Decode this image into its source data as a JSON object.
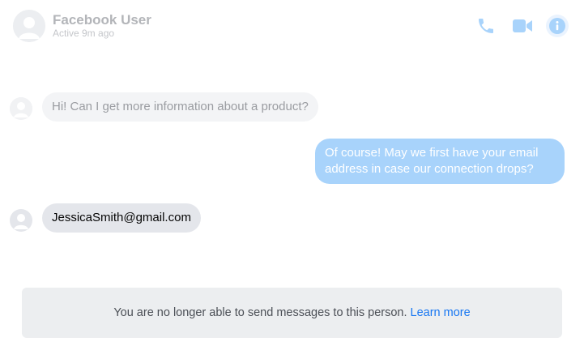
{
  "header": {
    "name": "Facebook User",
    "status": "Active 9m ago",
    "icons": {
      "phone": "phone-icon",
      "video": "video-camera-icon",
      "info": "info-icon"
    }
  },
  "messages": [
    {
      "direction": "incoming",
      "text": "Hi! Can I get more information about a product?",
      "faded": true
    },
    {
      "direction": "outgoing",
      "text": "Of course! May we first have your email address in case our connection drops?"
    },
    {
      "direction": "incoming",
      "text": "JessicaSmith@gmail.com"
    }
  ],
  "notice": {
    "text": "You are no longer able to send messages to this person.",
    "link_label": "Learn more"
  },
  "colors": {
    "accent": "#1877f2",
    "outgoing_bubble": "#a8d3fb",
    "incoming_bubble": "#e4e6eb"
  }
}
